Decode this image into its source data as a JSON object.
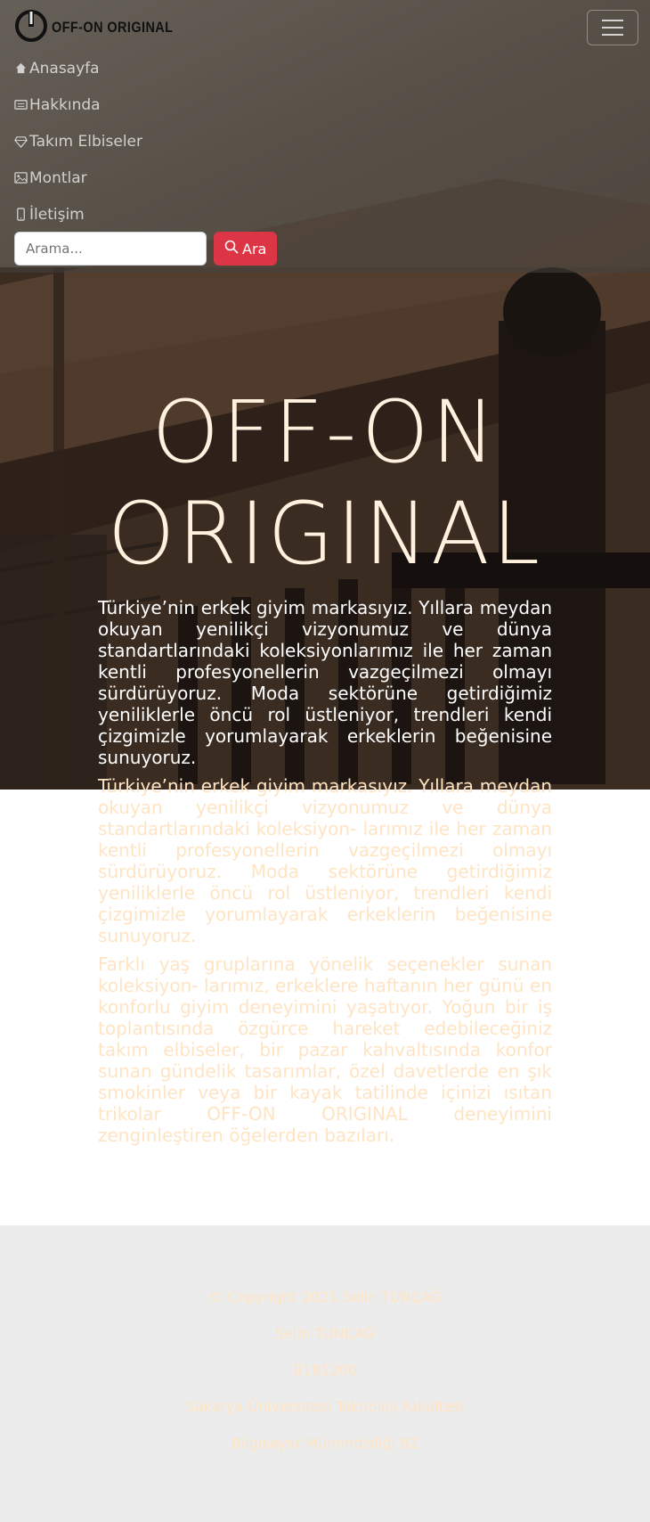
{
  "brand": {
    "name": "OFF-ON ORIGINAL",
    "logo_icon": "power-icon"
  },
  "nav": {
    "items": [
      {
        "label": "Anasayfa",
        "icon": "house-icon"
      },
      {
        "label": "Hakkında",
        "icon": "card-icon"
      },
      {
        "label": "Takım Elbiseler",
        "icon": "gem-icon"
      },
      {
        "label": "Montlar",
        "icon": "image-icon"
      },
      {
        "label": "İletişim",
        "icon": "phone-icon"
      }
    ],
    "toggler_icon": "hamburger-icon"
  },
  "search": {
    "placeholder": "Arama...",
    "button_label": "Ara",
    "button_icon": "search-icon"
  },
  "hero": {
    "title_line1": "OFF-ON",
    "title_line2": "ORIGINAL",
    "paragraphs": [
      "Türkiye’nin erkek giyim markasıyız. Yıllara meydan okuyan yenilikçi vizyonumuz ve dünya standartlarındaki koleksiyonlarımız ile her zaman kentli profesyonellerin vazgeçilmezi olmayı sürdürüyoruz. Moda sektörüne getirdiğimiz yeniliklerle öncü rol üstleniyor, trendleri kendi çizgimizle yorumlayarak erkeklerin beğenisine sunuyoruz.",
      "Türkiye’nin erkek giyim markasıyız. Yıllara meydan okuyan yenilikçi vizyonumuz ve dünya standartlarındaki koleksiyon- larımız ile her zaman kentli profesyonellerin vazgeçilmezi olmayı sürdürüyoruz. Moda sektörüne getirdiğimiz yeniliklerle öncü rol üstleniyor, trendleri kendi çizgimizle yorumlayarak erkeklerin beğenisine sunuyoruz.",
      "Farklı yaş gruplarına yönelik seçenekler sunan koleksiyon- larımız, erkeklere haftanın her günü en konforlu giyim deneyimini yaşatıyor. Yoğun bir iş toplantısında özgürce hareket edebileceğiniz takım elbiseler, bir pazar kahvaltısında konfor sunan gündelik tasarımlar, özel davetlerde en şık smokinler veya bir kayak tatilinde içinizi ısıtan trikolar OFF-ON ORIGINAL deneyimini zenginleştiren öğelerden bazıları."
    ]
  },
  "footer": {
    "lines": [
      "© Copyright 2021 Selin TUNÇAĞ",
      "Selin TUNÇAĞ",
      "B181200",
      "Sakarya Üniversitesi Teknoloji Fakültesi",
      "Bilgisayar Mühendisliği B2"
    ]
  },
  "colors": {
    "accent_red": "#dc3545",
    "headline": "#fff1de",
    "body_text": "#ffe4c4",
    "footer_bg": "#ececec"
  }
}
